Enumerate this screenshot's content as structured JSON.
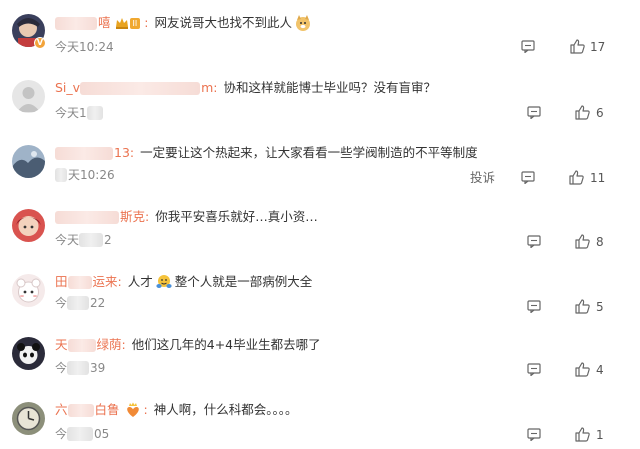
{
  "comments": [
    {
      "name_visible": "嘻",
      "content": "网友说哥大也找不到此人",
      "time_prefix": "今天",
      "time_suffix": "10:24",
      "likes": "17",
      "crown_level": "II"
    },
    {
      "name_visible": "Si_v",
      "name_tail": "m",
      "content": "协和这样就能博士毕业吗？没有盲审？",
      "time_prefix": "今天",
      "time_suffix": "1",
      "likes": "6"
    },
    {
      "name_visible": "13",
      "content": "一定要让这个热起来，让大家看看一些学阀制造的不平等制度",
      "time_prefix": "",
      "time_suffix": "天10:26",
      "likes": "11",
      "report_label": "投诉"
    },
    {
      "name_visible": "斯克",
      "content": "你我平安喜乐就好…真小资…",
      "time_prefix": "今天",
      "time_suffix": "2",
      "likes": "8"
    },
    {
      "name_visible": "田",
      "name_tail": "运来",
      "content_a": "人才",
      "content_b": "整个人就是一部病例大全",
      "time_prefix": "今",
      "time_suffix": "22",
      "likes": "5"
    },
    {
      "name_visible": "天",
      "name_tail": "绿荫",
      "content": "他们这几年的4+4毕业生都去哪了",
      "time_prefix": "今",
      "time_suffix": "39",
      "likes": "4"
    },
    {
      "name_visible": "六",
      "name_tail": "白鲁",
      "content": "神人啊，什么科都会。。。。",
      "time_prefix": "今",
      "time_suffix": "05",
      "likes": "1"
    }
  ],
  "icons": {
    "reply": "reply-icon",
    "like": "thumbs-up-icon",
    "verified": "verified-v-icon"
  },
  "colors": {
    "name": "#eb7350",
    "text": "#333333",
    "meta": "#888888"
  }
}
